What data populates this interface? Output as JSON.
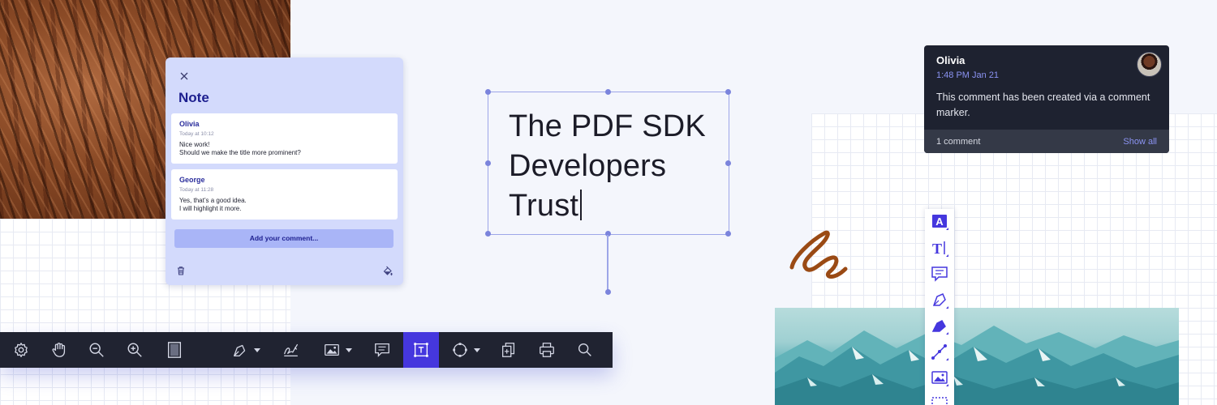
{
  "note_panel": {
    "title": "Note",
    "comments": [
      {
        "author": "Olivia",
        "time": "Today at 10:12",
        "lines": [
          "Nice work!",
          "Should we make the title more prominent?"
        ]
      },
      {
        "author": "George",
        "time": "Today at 11:28",
        "lines": [
          "Yes, that’s a good idea.",
          "I will highlight it more."
        ]
      }
    ],
    "add_comment_label": "Add your comment..."
  },
  "headline": {
    "lines": [
      "The PDF SDK",
      "Developers",
      "Trust"
    ]
  },
  "comment_popover": {
    "author": "Olivia",
    "time": "1:48 PM Jan 21",
    "text": "This comment has been created via a comment marker.",
    "count_label": "1 comment",
    "show_all_label": "Show all"
  },
  "colors": {
    "accent": "#4537de",
    "toolbar_bg": "#202331",
    "note_bg": "#d3dafc",
    "squiggle": "#9a4a14"
  },
  "main_toolbar": {
    "tools": [
      "settings-icon",
      "pan-hand-icon",
      "zoom-out-icon",
      "zoom-in-icon",
      "page-layout-icon",
      "ink-pen-icon",
      "signature-icon",
      "image-icon",
      "note-icon",
      "text-annotation-icon",
      "shapes-icon",
      "document-editor-icon",
      "print-icon",
      "search-icon"
    ],
    "active_tool": "text-annotation-icon"
  },
  "vertical_toolbar": {
    "tools": [
      "text-highlighter-icon",
      "text-icon",
      "comment-icon",
      "pen-icon",
      "highlighter-icon",
      "line-icon",
      "image-icon",
      "selection-icon"
    ]
  }
}
